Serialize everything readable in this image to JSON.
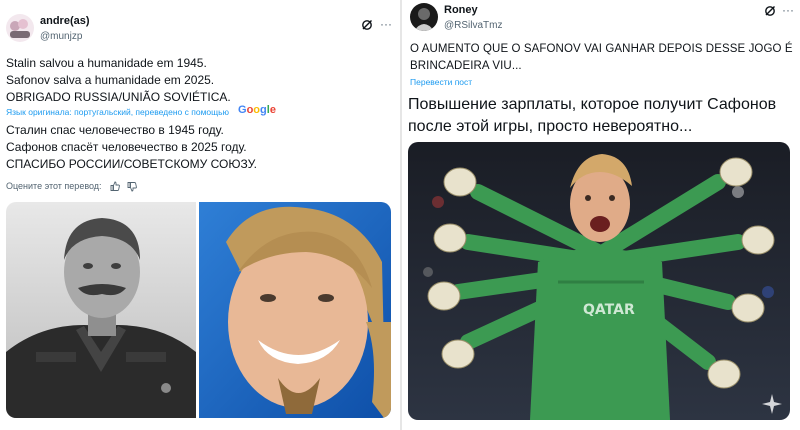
{
  "left_post": {
    "author_name": "andre(as)",
    "author_handle": "@munjzp",
    "text_lines": [
      "Stalin salvou a humanidade em 1945.",
      "Safonov salva a humanidade em 2025.",
      "OBRIGADO RUSSIA/UNIÃO SOVIÉTICA."
    ],
    "translation_note": "Язык оригинала: португальский, переведено с помощью",
    "translator_logo": "Google",
    "translated_lines": [
      "Сталин спас человечество в 1945 году.",
      "Сафонов спасёт человечество в 2025 году.",
      "СПАСИБО РОССИИ/СОВЕТСКОМУ СОЮЗУ."
    ],
    "rate_label": "Оцените этот перевод:"
  },
  "right_post": {
    "author_name": "Roney",
    "author_handle": "@RSilvaTmz",
    "text_lines": [
      "O AUMENTO QUE O SAFONOV VAI GANHAR DEPOIS DESSE JOGO É",
      "BRINCADEIRA VIU..."
    ],
    "translate_link": "Перевести пост",
    "russian_lines": [
      "Повышение зарплаты, которое получит Сафонов",
      "после этой игры, просто невероятно..."
    ]
  },
  "colors": {
    "link": "#1d9bf0",
    "text": "#0f1419",
    "muted": "#536471",
    "keeper_green": "#3c9a52"
  },
  "icons": [
    "grok-icon",
    "more-icon",
    "thumbs-up-icon",
    "thumbs-down-icon",
    "sparkle-icon"
  ]
}
